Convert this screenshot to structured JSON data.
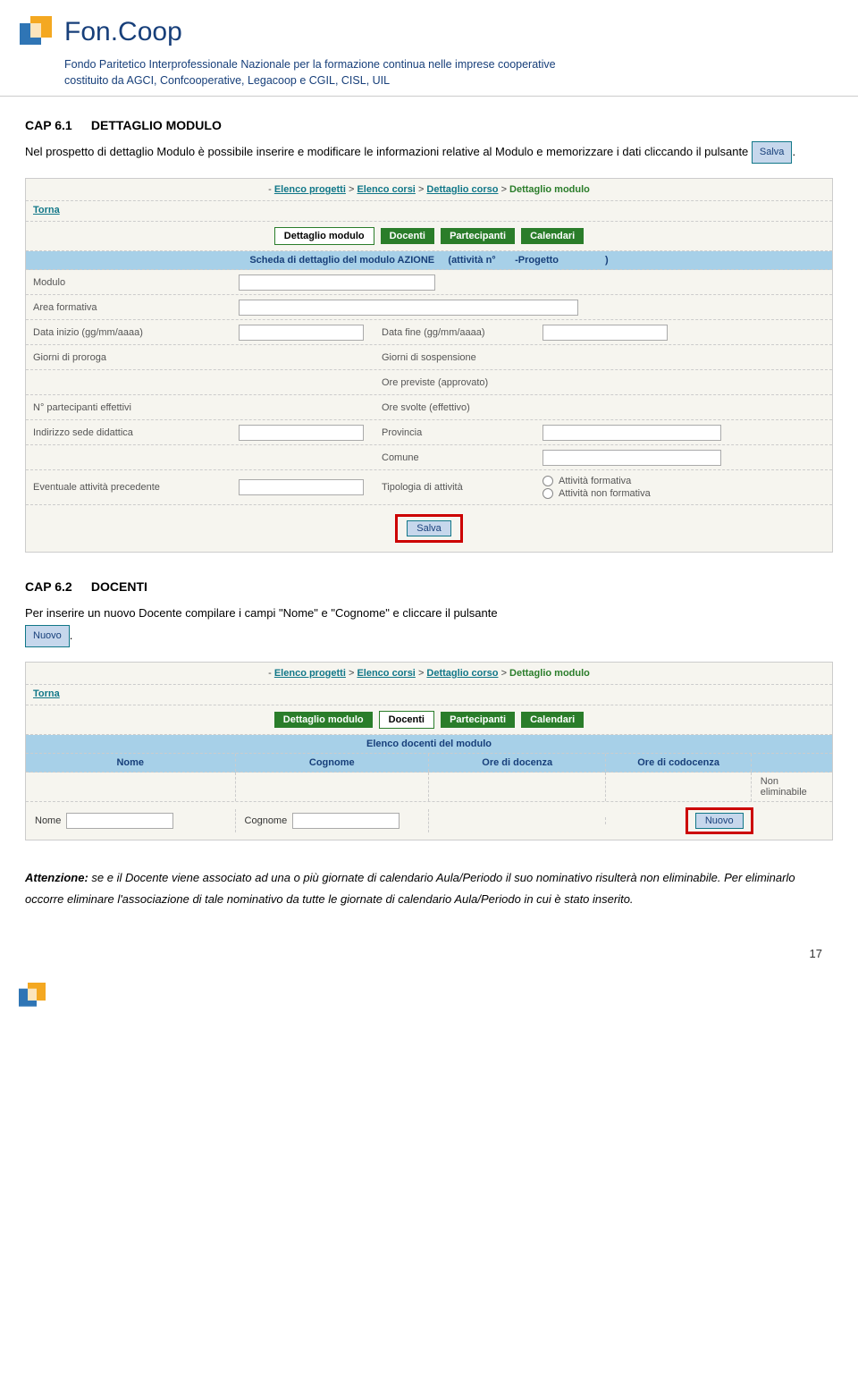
{
  "header": {
    "logo_text": "Fon.Coop",
    "subtitle_line1": "Fondo Paritetico Interprofessionale Nazionale per la formazione continua nelle imprese cooperative",
    "subtitle_line2": "costituito da AGCI, Confcooperative, Legacoop e CGIL, CISL, UIL"
  },
  "section1": {
    "cap_number": "CAP 6.1",
    "cap_title": "DETTAGLIO MODULO",
    "intro_before": "Nel prospetto di dettaglio Modulo è possibile inserire e modificare le informazioni relative al Modulo e memorizzare i dati cliccando il pulsante ",
    "salva_btn": "Salva",
    "intro_after": "."
  },
  "panel1": {
    "breadcrumb": {
      "prefix": "- ",
      "l1": "Elenco progetti",
      "sep": " > ",
      "l2": "Elenco corsi",
      "l3": "Dettaglio corso",
      "l4": "Dettaglio modulo"
    },
    "torna": "Torna",
    "tabs": {
      "dettaglio": "Dettaglio modulo",
      "docenti": "Docenti",
      "partecipanti": "Partecipanti",
      "calendari": "Calendari"
    },
    "scheda_header_left": "Scheda di dettaglio del modulo AZIONE",
    "scheda_header_mid": "(attività n°",
    "scheda_header_right": "-Progetto",
    "scheda_header_close": ")",
    "labels": {
      "modulo": "Modulo",
      "area": "Area formativa",
      "data_inizio": "Data inizio (gg/mm/aaaa)",
      "data_fine": "Data fine (gg/mm/aaaa)",
      "giorni_proroga": "Giorni di proroga",
      "giorni_sosp": "Giorni di sospensione",
      "ore_prev": "Ore previste (approvato)",
      "n_part": "N° partecipanti effettivi",
      "ore_svolte": "Ore svolte (effettivo)",
      "indirizzo": "Indirizzo sede didattica",
      "provincia": "Provincia",
      "comune": "Comune",
      "eventuale": "Eventuale attività precedente",
      "tipologia": "Tipologia di attività",
      "radio1": "Attività formativa",
      "radio2": "Attività non formativa"
    },
    "salva": "Salva"
  },
  "section2": {
    "cap_number": "CAP 6.2",
    "cap_title": "DOCENTI",
    "intro_before": "Per inserire un nuovo Docente compilare i campi \"Nome\" e \"Cognome\" e cliccare il pulsante",
    "nuovo_btn": "Nuovo",
    "intro_after": "."
  },
  "panel2": {
    "elenco_header": "Elenco docenti del modulo",
    "cols": {
      "nome": "Nome",
      "cognome": "Cognome",
      "ore_doc": "Ore di docenza",
      "ore_codoc": "Ore di codocenza"
    },
    "non_elim": "Non eliminabile",
    "lbl_nome": "Nome",
    "lbl_cognome": "Cognome",
    "nuovo": "Nuovo"
  },
  "attention": {
    "label": "Attenzione:",
    "text": " se e il Docente viene associato ad una o più giornate di calendario Aula/Periodo il suo nominativo risulterà non eliminabile. Per eliminarlo occorre eliminare l'associazione di tale nominativo da tutte le giornate di calendario Aula/Periodo in cui è stato inserito."
  },
  "page_number": "17"
}
